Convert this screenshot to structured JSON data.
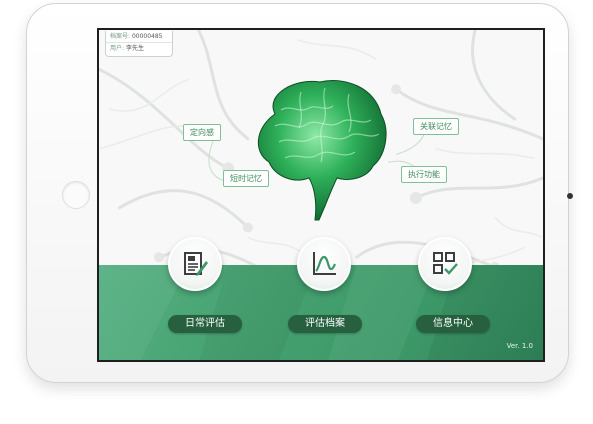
{
  "account": {
    "file_no_label": "档案号:",
    "file_no_value": "00000485",
    "user_label": "用户:",
    "user_value": "李先生"
  },
  "brain_tags": {
    "orientation": "定向感",
    "short_term": "短时记忆",
    "associative": "关联记忆",
    "executive": "执行功能"
  },
  "actions": [
    {
      "label": "日常评估",
      "icon": "document-edit-icon"
    },
    {
      "label": "评估档案",
      "icon": "line-chart-icon"
    },
    {
      "label": "信息中心",
      "icon": "grid-check-icon"
    }
  ],
  "version": "Ver. 1.0",
  "colors": {
    "accent": "#3d9868",
    "pill": "#26603f",
    "tag_border": "#7fbf95"
  }
}
